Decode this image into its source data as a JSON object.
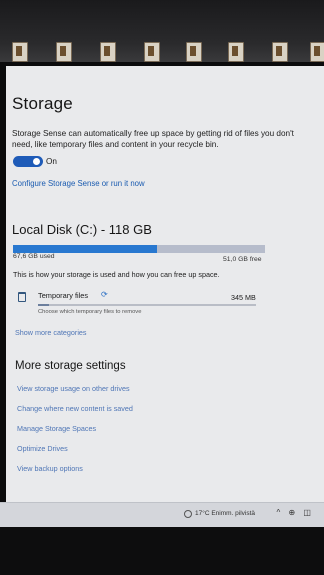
{
  "page": {
    "title": "Storage"
  },
  "storage_sense": {
    "description": "Storage Sense can automatically free up space by getting rid of files you don't need, like temporary files and content in your recycle bin.",
    "toggle_state": "On",
    "toggle_on": true,
    "configure_link": "Configure Storage Sense or run it now"
  },
  "local_disk": {
    "title": "Local Disk (C:) - 118 GB",
    "used_label": "67,6 GB used",
    "free_label": "51,0 GB free",
    "used_fraction": 0.57,
    "note": "This is how your storage is used and how you can free up space."
  },
  "categories": [
    {
      "name": "Temporary files",
      "size": "345 MB",
      "subtitle": "Choose which temporary files to remove",
      "fill_fraction": 0.05
    }
  ],
  "show_more_link": "Show more categories",
  "more_settings": {
    "heading": "More storage settings",
    "links": [
      "View storage usage on other drives",
      "Change where new content is saved",
      "Manage Storage Spaces",
      "Optimize Drives",
      "View backup options"
    ]
  },
  "taskbar": {
    "weather": "17°C  Enimm. pilvistä",
    "tray": "^ ⊕ ◫"
  },
  "colors": {
    "accent": "#2878d0",
    "link": "#1a5bb0"
  }
}
